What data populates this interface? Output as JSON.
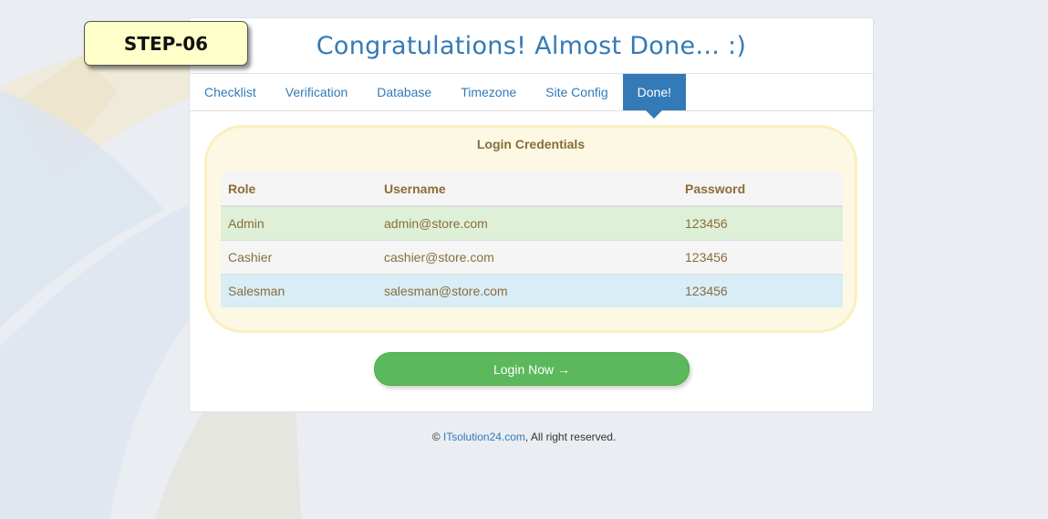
{
  "step_badge": "STEP-06",
  "panel": {
    "title": "Congratulations! Almost Done... :)"
  },
  "tabs": [
    {
      "label": "Checklist",
      "active": false
    },
    {
      "label": "Verification",
      "active": false
    },
    {
      "label": "Database",
      "active": false
    },
    {
      "label": "Timezone",
      "active": false
    },
    {
      "label": "Site Config",
      "active": false
    },
    {
      "label": "Done!",
      "active": true
    }
  ],
  "credentials": {
    "title": "Login Credentials",
    "headers": [
      "Role",
      "Username",
      "Password"
    ],
    "rows": [
      {
        "role": "Admin",
        "username": "admin@store.com",
        "password": "123456"
      },
      {
        "role": "Cashier",
        "username": "cashier@store.com",
        "password": "123456"
      },
      {
        "role": "Salesman",
        "username": "salesman@store.com",
        "password": "123456"
      }
    ]
  },
  "login_button": "Login Now →",
  "footer": {
    "prefix": "© ",
    "link": "ITsolution24.com",
    "suffix": ", All right reserved."
  },
  "colors": {
    "accent": "#337ab7",
    "success": "#5cb85c",
    "warning_bg": "#fcf8e3",
    "badge_bg": "#ffffc9"
  }
}
